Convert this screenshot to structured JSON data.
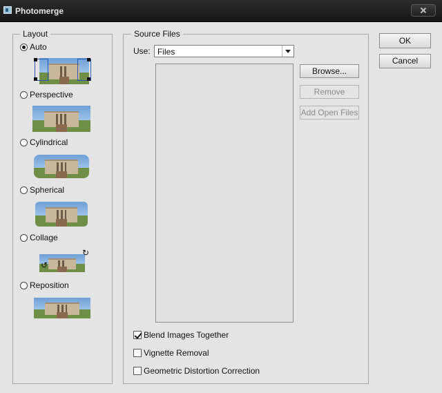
{
  "window": {
    "title": "Photomerge"
  },
  "layout": {
    "legend": "Layout",
    "options": [
      {
        "label": "Auto",
        "checked": true
      },
      {
        "label": "Perspective",
        "checked": false
      },
      {
        "label": "Cylindrical",
        "checked": false
      },
      {
        "label": "Spherical",
        "checked": false
      },
      {
        "label": "Collage",
        "checked": false
      },
      {
        "label": "Reposition",
        "checked": false
      }
    ]
  },
  "source": {
    "legend": "Source Files",
    "use_label": "Use:",
    "use_value": "Files",
    "browse_label": "Browse...",
    "remove_label": "Remove",
    "add_open_label": "Add Open Files",
    "options": [
      {
        "label": "Blend Images Together",
        "checked": true
      },
      {
        "label": "Vignette Removal",
        "checked": false
      },
      {
        "label": "Geometric Distortion Correction",
        "checked": false
      }
    ]
  },
  "buttons": {
    "ok": "OK",
    "cancel": "Cancel"
  }
}
